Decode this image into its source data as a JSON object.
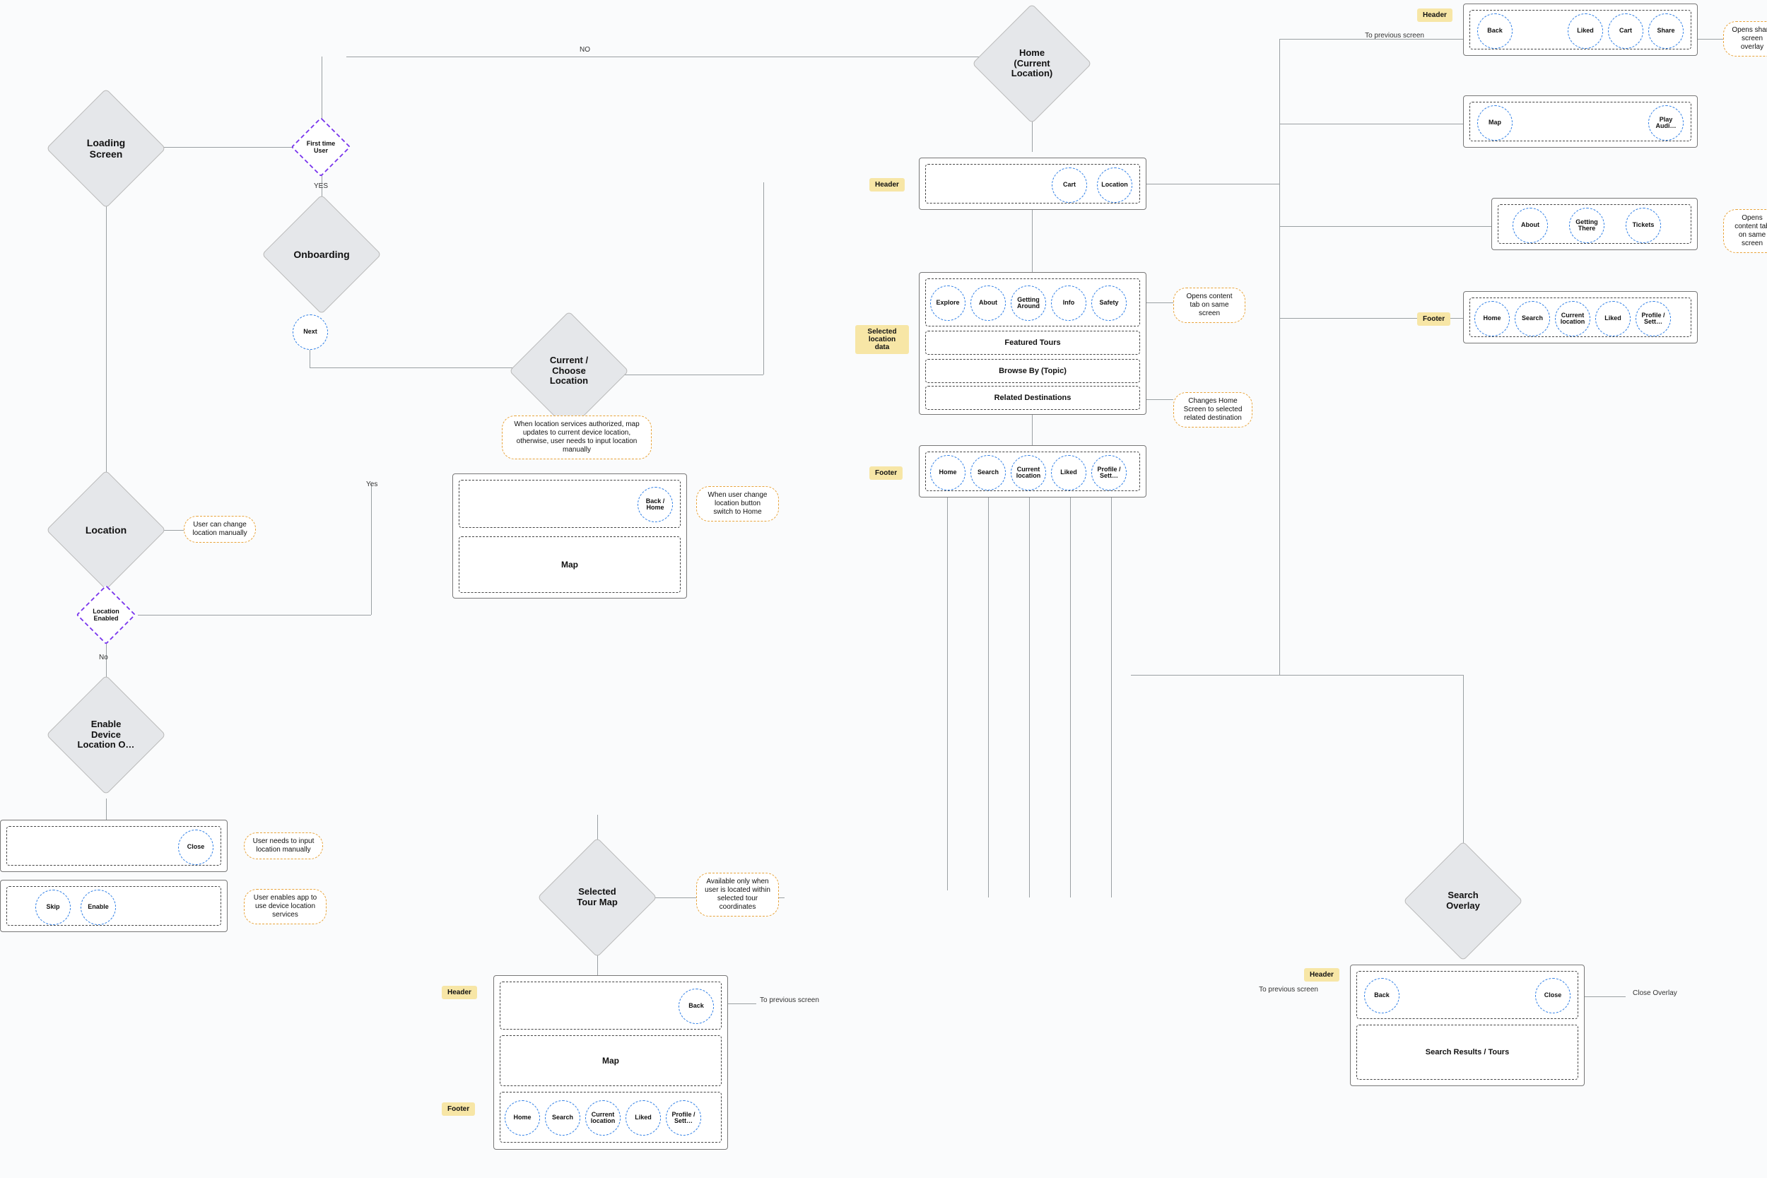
{
  "screens": {
    "loading": "Loading Screen",
    "onboarding": "Onboarding",
    "location": "Location",
    "enable_device": "Enable Device Location O…",
    "current_choose": "Current / Choose Location",
    "home": "Home (Current Location)",
    "selected_tour_map": "Selected Tour Map",
    "search_overlay": "Search Overlay"
  },
  "decisions": {
    "first_time_user": "First time User",
    "location_enabled": "Location Enabled"
  },
  "edge_labels": {
    "no_upper": "NO",
    "yes": "YES",
    "yes_vert": "Yes",
    "no_vert": "No",
    "to_previous_screen": "To previous screen",
    "close_overlay": "Close Overlay"
  },
  "notes": {
    "user_can_change": "User can change location manually",
    "loc_auth": "When location services authorized, map updates to current device location, otherwise, user needs to input location manually",
    "back_home_switch": "When user change location button switch to Home",
    "user_input_manual": "User needs to input location manually",
    "user_enables_app": "User enables app to use device location services",
    "opens_content_same": "Opens content tab on same screen",
    "changes_home_related": "Changes Home Screen to selected related destination",
    "available_only": "Available only when user is located within selected tour coordinates",
    "opens_share": "Opens share screen overlay",
    "opens_content_same2": "Opens content tab on same screen"
  },
  "tags": {
    "header": "Header",
    "footer": "Footer",
    "selected_location_data": "Selected location data"
  },
  "buttons": {
    "next": "Next",
    "close": "Close",
    "skip": "Skip",
    "enable": "Enable",
    "back_home": "Back / Home",
    "back": "Back",
    "cart": "Cart",
    "location": "Location",
    "explore": "Explore",
    "about": "About",
    "getting_around": "Getting Around",
    "info": "Info",
    "safety": "Safety",
    "home": "Home",
    "search": "Search",
    "current_location": "Current location",
    "liked": "Liked",
    "profile_sett": "Profile / Sett…",
    "map": "Map",
    "play_audio": "Play Audi…",
    "getting_there": "Getting There",
    "tickets": "Tickets",
    "share": "Share"
  },
  "blocks": {
    "map": "Map",
    "featured_tours": "Featured Tours",
    "browse_by_topic": "Browse By (Topic)",
    "related_destinations": "Related Destinations",
    "search_results": "Search Results / Tours"
  }
}
